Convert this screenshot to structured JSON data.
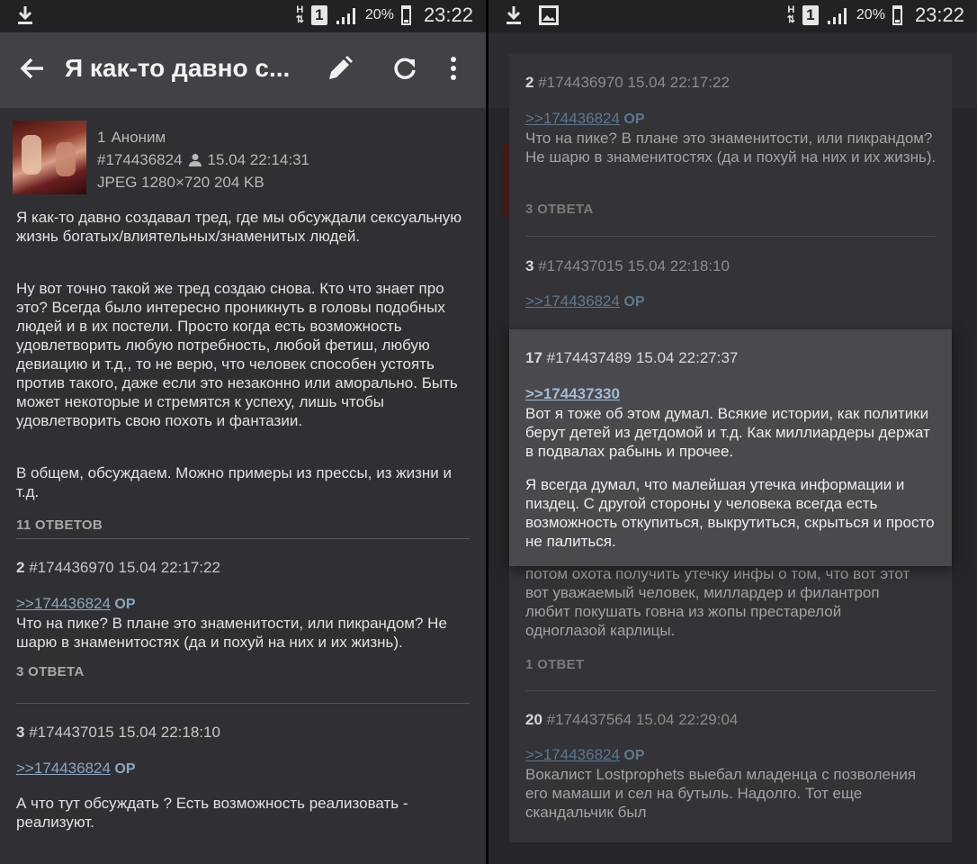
{
  "status": {
    "time": "23:22",
    "battery": "20%",
    "network": "H",
    "sim": "1",
    "left_icons_left": [
      "download-icon"
    ],
    "left_icons_right": [
      "download-icon",
      "image-icon"
    ]
  },
  "toolbar": {
    "title": "Я как-то давно с..."
  },
  "op": {
    "number": "1",
    "author": "Аноним",
    "post_id": "#174436824",
    "datetime": "15.04 22:14:31",
    "file_info": "JPEG 1280×720 204 KB",
    "paragraphs": [
      "Я как-то давно создавал тред, где мы обсуждали сексуальную жизнь богатых/влиятельных/знаменитых людей.",
      "Ну вот точно такой же тред создаю снова. Кто что знает про это? Всегда было интересно проникнуть в головы подобных людей и в их постели. Просто когда есть возможность удовлетворить любую потребность, любой фетиш, любую девиацию и т.д., то не верю, что человек способен устоять против такого, даже если это незаконно или аморально. Быть может некоторые и стремятся к успеху, лишь чтобы удовлетворить свою похоть и фантазии.",
      "В общем, обсуждаем. Можно примеры из прессы, из жизни и т.д."
    ],
    "answers": "11 ОТВЕТОВ"
  },
  "post2": {
    "number": "2",
    "post_id": "#174436970",
    "datetime": "15.04 22:17:22",
    "reply_link": ">>174436824",
    "op_tag": "OP",
    "text": "Что на пике? В плане это знаменитости, или пикрандом? Не шарю в знаменитостях (да и похуй на них и их жизнь).",
    "answers": "3 ОТВЕТА"
  },
  "post3": {
    "number": "3",
    "post_id": "#174437015",
    "datetime": "15.04 22:18:10",
    "reply_link": ">>174436824",
    "op_tag": "OP",
    "text": "А что тут обсуждать ? Есть возможность реализовать - реализуют."
  },
  "popup_post17": {
    "number": "17",
    "post_id": "#174437489",
    "datetime": "15.04 22:27:37",
    "reply_link": ">>174437330",
    "paragraphs": [
      "Вот я тоже об этом думал. Всякие истории, как политики берут детей из детдомой и т.д. Как миллиардеры держат в подвалах рабынь и прочее.",
      "Я всегда думал, что малейшая утечка информации и пиздец. С другой стороны у человека всегда есть возможность откупиться, выкрутиться, скрыться и просто не палиться."
    ]
  },
  "behind_card_text": "потом охота получить утечку инфы о том, что вот этот вот уважаемый человек, миллардер и филантроп любит покушать говна из жопы престарелой одноглазой карлицы.",
  "behind_card_answers": "1 ОТВЕТ",
  "post20": {
    "number": "20",
    "post_id": "#174437564",
    "datetime": "15.04 22:29:04",
    "reply_link": ">>174436824",
    "op_tag": "OP",
    "text": "Вокалист Lostprophets выебал младенца с позволения его мамаши и сел на бутыль. Надолго. Тот еще скандальчик был"
  }
}
